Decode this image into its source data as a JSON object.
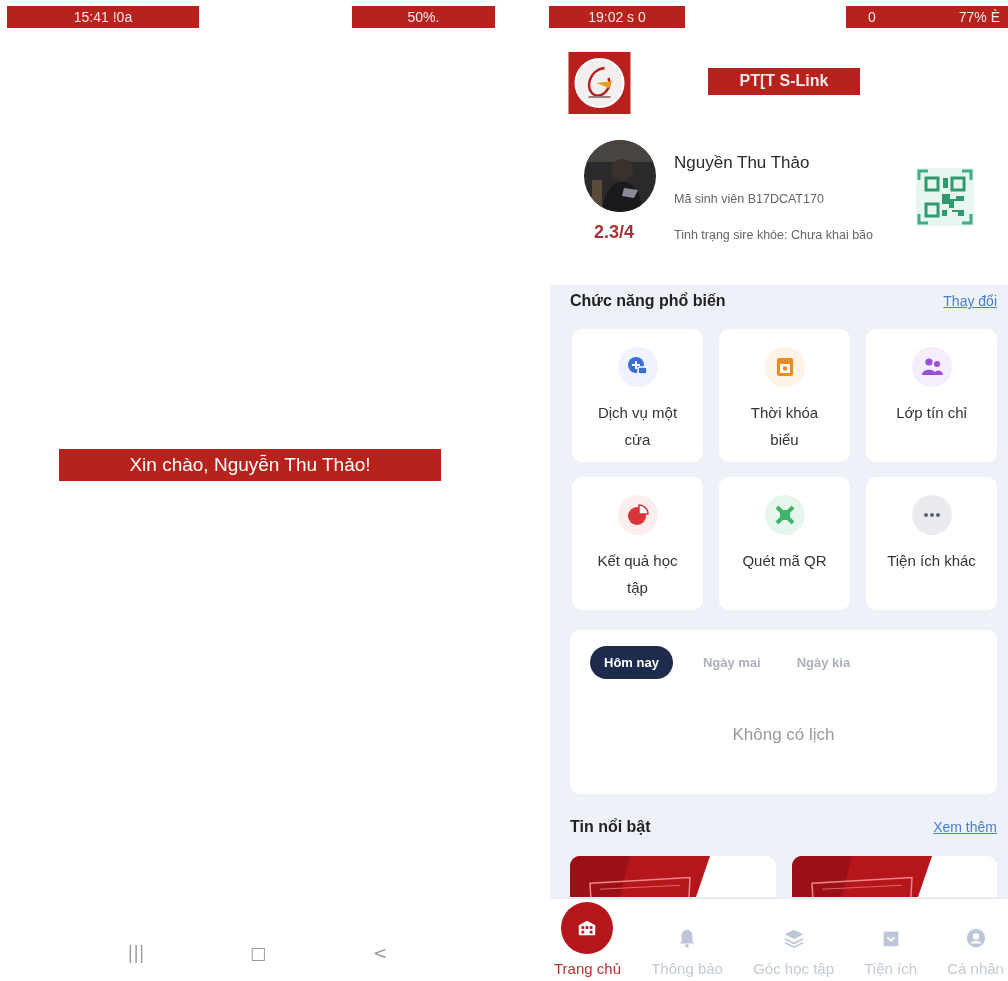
{
  "left_screen": {
    "status_bar": {
      "time": "15:41 !0a",
      "battery": "50%."
    },
    "greeting": "Xin chào, Nguyễn Thu Thảo!",
    "nav_buttons": [
      "|||",
      "□",
      "<"
    ]
  },
  "right_screen": {
    "status_bar": {
      "time": "19:02 s 0",
      "signal": "0",
      "battery": "77% È"
    },
    "app_title": "PT[T S-Link",
    "profile": {
      "name": "Nguyền Thu Thảo",
      "student_id": "Mã sinh viên B17DCAT170",
      "rating": "2.3/4",
      "health_status": "Tinh trạng sire khóe: Chưa khai bão"
    },
    "features": {
      "title": "Chức năng phổ biến",
      "action": "Thay đổi",
      "items": [
        {
          "label": "Dịch vụ một cửa",
          "kind": "service"
        },
        {
          "label": "Thời khóa biểu",
          "kind": "timetable"
        },
        {
          "label": "Lớp tín chỉ",
          "kind": "class"
        },
        {
          "label": "Kết quả học tập",
          "kind": "results"
        },
        {
          "label": "Quét mã QR",
          "kind": "qr"
        },
        {
          "label": "Tiện ích khác",
          "kind": "more"
        }
      ]
    },
    "schedule": {
      "tabs": [
        {
          "label": "Hôm nay",
          "selected": true
        },
        {
          "label": "Ngày mai",
          "selected": false
        },
        {
          "label": "Ngày kia",
          "selected": false
        }
      ],
      "empty_text": "Không có lịch"
    },
    "news": {
      "title": "Tin nổi bật",
      "action": "Xem thêm"
    },
    "bottom_nav": [
      {
        "label": "Trang chủ",
        "kind": "home",
        "selected": true
      },
      {
        "label": "Thông báo",
        "kind": "bell",
        "selected": false
      },
      {
        "label": "Góc học tập",
        "kind": "layers",
        "selected": false
      },
      {
        "label": "Tiện ích",
        "kind": "bag",
        "selected": false
      },
      {
        "label": "Cá nhân",
        "kind": "person",
        "selected": false
      }
    ]
  }
}
